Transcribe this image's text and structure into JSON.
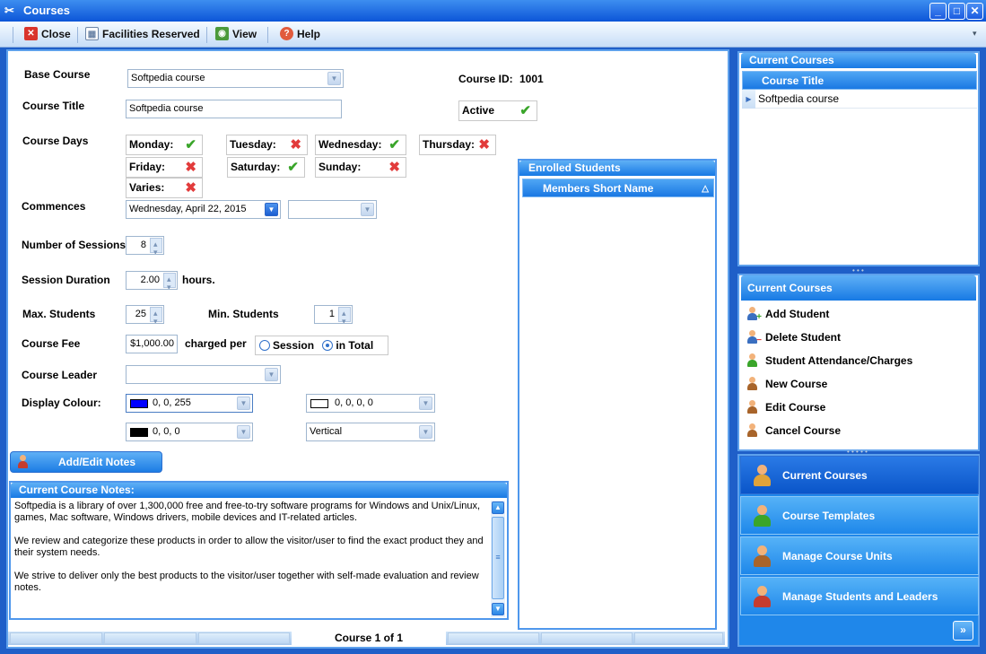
{
  "window": {
    "title": "Courses"
  },
  "toolbar": {
    "close": "Close",
    "facilities": "Facilities Reserved",
    "view": "View",
    "help": "Help"
  },
  "form": {
    "base_course_label": "Base Course",
    "base_course_value": "Softpedia course",
    "course_id_label": "Course ID:",
    "course_id_value": "1001",
    "course_title_label": "Course Title",
    "course_title_value": "Softpedia course",
    "active_label": "Active",
    "course_days_label": "Course Days",
    "days": [
      {
        "name": "Monday:",
        "on": true
      },
      {
        "name": "Tuesday:",
        "on": false
      },
      {
        "name": "Wednesday:",
        "on": true
      },
      {
        "name": "Thursday:",
        "on": false
      },
      {
        "name": "Friday:",
        "on": false
      },
      {
        "name": "Saturday:",
        "on": true
      },
      {
        "name": "Sunday:",
        "on": false
      },
      {
        "name": "Varies:",
        "on": false
      }
    ],
    "commences_label": "Commences",
    "commences_value": "Wednesday, April 22, 2015",
    "sessions_label": "Number of Sessions",
    "sessions_value": "8",
    "duration_label": "Session Duration",
    "duration_value": "2.00",
    "hours_label": "hours.",
    "max_students_label": "Max. Students",
    "max_students_value": "25",
    "min_students_label": "Min. Students",
    "min_students_value": "1",
    "fee_label": "Course Fee",
    "fee_value": "$1,000.00",
    "charged_per_label": "charged per",
    "session_option": "Session",
    "total_option": "in Total",
    "leader_label": "Course Leader",
    "display_colour_label": "Display Colour:",
    "colour1_value": "0, 0, 255",
    "colour2_value": "0, 0, 0, 0",
    "colour3_value": "0, 0, 0",
    "orientation_value": "Vertical",
    "add_notes_label": "Add/Edit Notes",
    "notes_header": "Current Course Notes:",
    "notes_p1": "Softpedia is a library of over 1,300,000 free and free-to-try software programs for Windows and Unix/Linux, games, Mac software, Windows drivers, mobile devices and IT-related articles.",
    "notes_p2": "We review and categorize these products in order to allow the visitor/user to find the exact product they and their system needs.",
    "notes_p3": "We strive to deliver only the best products to the visitor/user together with self-made evaluation and review notes.",
    "pager_label": "Course 1 of 1"
  },
  "enrolled": {
    "header": "Enrolled Students",
    "column": "Members Short Name"
  },
  "current_courses": {
    "header": "Current Courses",
    "column": "Course Title",
    "rows": [
      "Softpedia course"
    ]
  },
  "actions": {
    "header": "Current Courses",
    "items": [
      "Add Student",
      "Delete Student",
      "Student Attendance/Charges",
      "New Course",
      "Edit Course",
      "Cancel Course"
    ]
  },
  "nav": {
    "items": [
      "Current Courses",
      "Course Templates",
      "Manage Course Units",
      "Manage Students and Leaders"
    ]
  },
  "colors": {
    "accent": "#1f7ae4",
    "check": "#3aa52a",
    "cross": "#e23b3b",
    "swatch_blue": "#0000ff"
  }
}
